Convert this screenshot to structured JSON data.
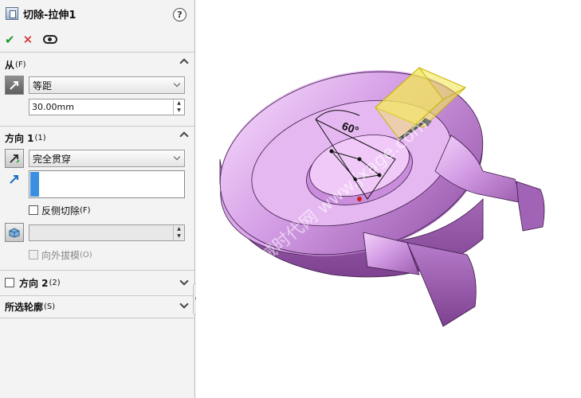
{
  "feature": {
    "title": "切除-拉伸1",
    "help_icon": "?",
    "ok_icon": "✔",
    "cancel_icon": "✕"
  },
  "from": {
    "label": "从",
    "key": "(F)",
    "type_value": "等距",
    "distance_value": "30.00mm"
  },
  "direction1": {
    "label": "方向 1",
    "key": "(1)",
    "end_condition": "完全贯穿",
    "flip_side_label": "反侧切除",
    "flip_side_key": "(F)",
    "draft_value": "",
    "draft_outward_label": "向外拔模",
    "draft_outward_key": "(O)"
  },
  "direction2": {
    "label": "方向 2",
    "key": "(2)"
  },
  "contours": {
    "label": "所选轮廓",
    "key": "(S)"
  },
  "viewport": {
    "dimension_label": "60°",
    "watermark": "机械时代网 www.jxage.com",
    "part_color": "#d8a3e8",
    "part_shadow": "#8d4ea0",
    "preview_color": "#f3e85a"
  }
}
